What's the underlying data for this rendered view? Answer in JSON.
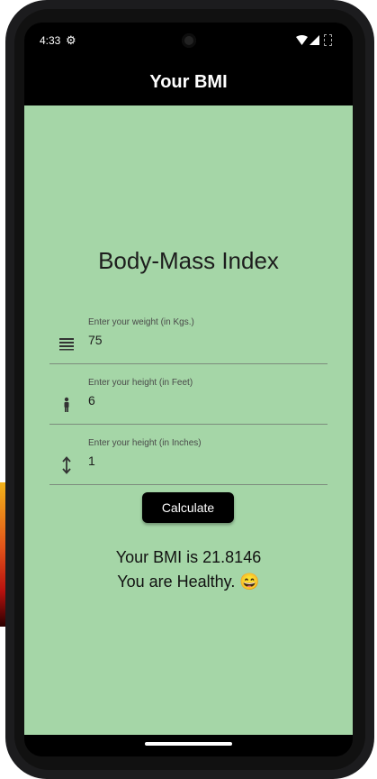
{
  "status_bar": {
    "time": "4:33"
  },
  "app_bar": {
    "title": "Your BMI"
  },
  "main": {
    "heading": "Body-Mass Index",
    "fields": [
      {
        "label": "Enter your weight (in Kgs.)",
        "value": "75",
        "icon": "weight-icon"
      },
      {
        "label": "Enter your height (in Feet)",
        "value": "6",
        "icon": "person-icon"
      },
      {
        "label": "Enter your height (in Inches)",
        "value": "1",
        "icon": "height-arrow-icon"
      }
    ],
    "calculate_label": "Calculate",
    "result_bmi": "Your BMI is 21.8146",
    "result_status": "You are Healthy. 😄"
  },
  "colors": {
    "content_bg": "#a5d6a7",
    "app_bar_bg": "#000000",
    "button_bg": "#000000"
  }
}
